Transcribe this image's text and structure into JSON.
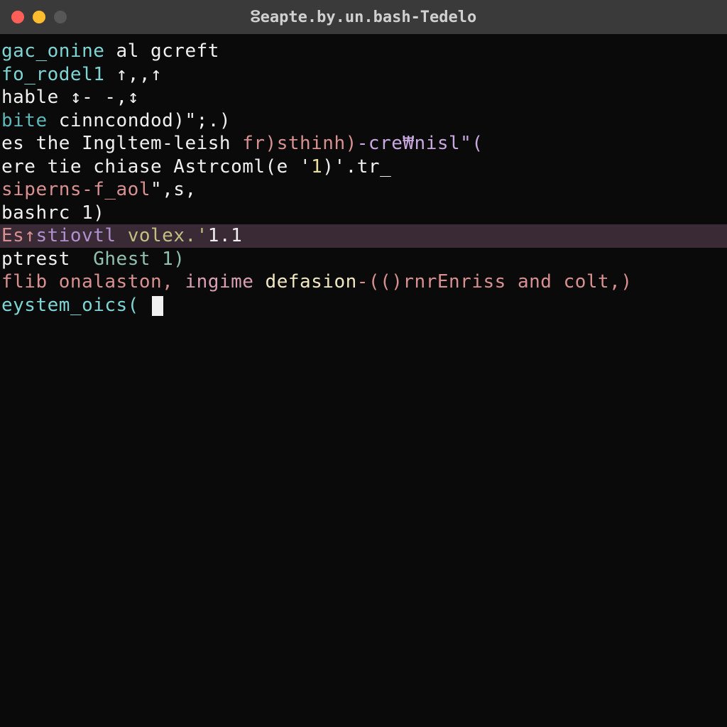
{
  "titlebar": {
    "title": "ⵓeapte.by.un.bash-Tedelo"
  },
  "lines": {
    "l1a": "gac_onine",
    "l1b": " al gcreft",
    "l2a": "fo_rodel1",
    "l2b": " ↑,,↑",
    "l3a": "hable",
    "l3b": " ↕- -,↕",
    "l4a": "bite",
    "l4b": " cinncondod)\";.)",
    "l5a": "es the Ingltem-leish ",
    "l5b": "fr)sthinh)",
    "l5c": "-cre₩nisl\"(",
    "l6a": "ere tie chiase Astrcoml(e '",
    "l6b": "1",
    "l6c": ")'.tr_",
    "l7a": "siperns-f_aol",
    "l7b": "\",s,",
    "l8": "",
    "l9a": "bashrc ",
    "l9b": "1)",
    "l10a": "Es↑",
    "l10b": "stiovtl",
    "l10c": " volex.'",
    "l10d": "1.1",
    "l11": "",
    "l12a": "ptrest  ",
    "l12b": "Ghest 1)",
    "l13a": "flib",
    "l13b": " onalaston, ",
    "l13c": "ingime",
    "l13d": " defasion",
    "l13e": "-(()",
    "l13f": "rnrEnriss",
    "l13g": " and colt,)",
    "l14": "",
    "l15a": "eystem_oics( "
  }
}
